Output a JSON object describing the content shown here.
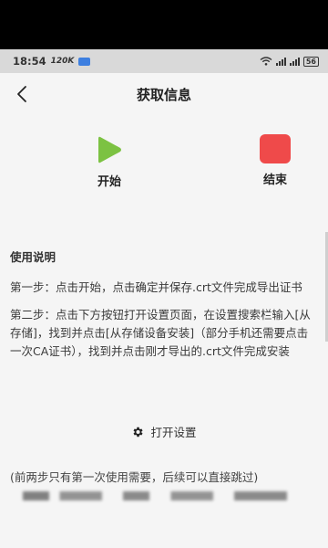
{
  "status_bar": {
    "time": "18:54",
    "network_speed": "120K",
    "battery": "56"
  },
  "nav": {
    "title": "获取信息"
  },
  "controls": {
    "start_label": "开始",
    "stop_label": "结束",
    "start_color": "#7cc242",
    "stop_color": "#ef4a4a"
  },
  "instructions": {
    "title": "使用说明",
    "step1": "第一步：点击开始，点击确定并保存.crt文件完成导出证书",
    "step2": "第二步：点击下方按钮打开设置页面，在设置搜索栏输入[从存储]，找到并点击[从存储设备安装]（部分手机还需要点击一次CA证书），找到并点击刚才导出的.crt文件完成安装"
  },
  "open_settings_label": "打开设置",
  "footnote": "(前两步只有第一次使用需要，后续可以直接跳过)"
}
